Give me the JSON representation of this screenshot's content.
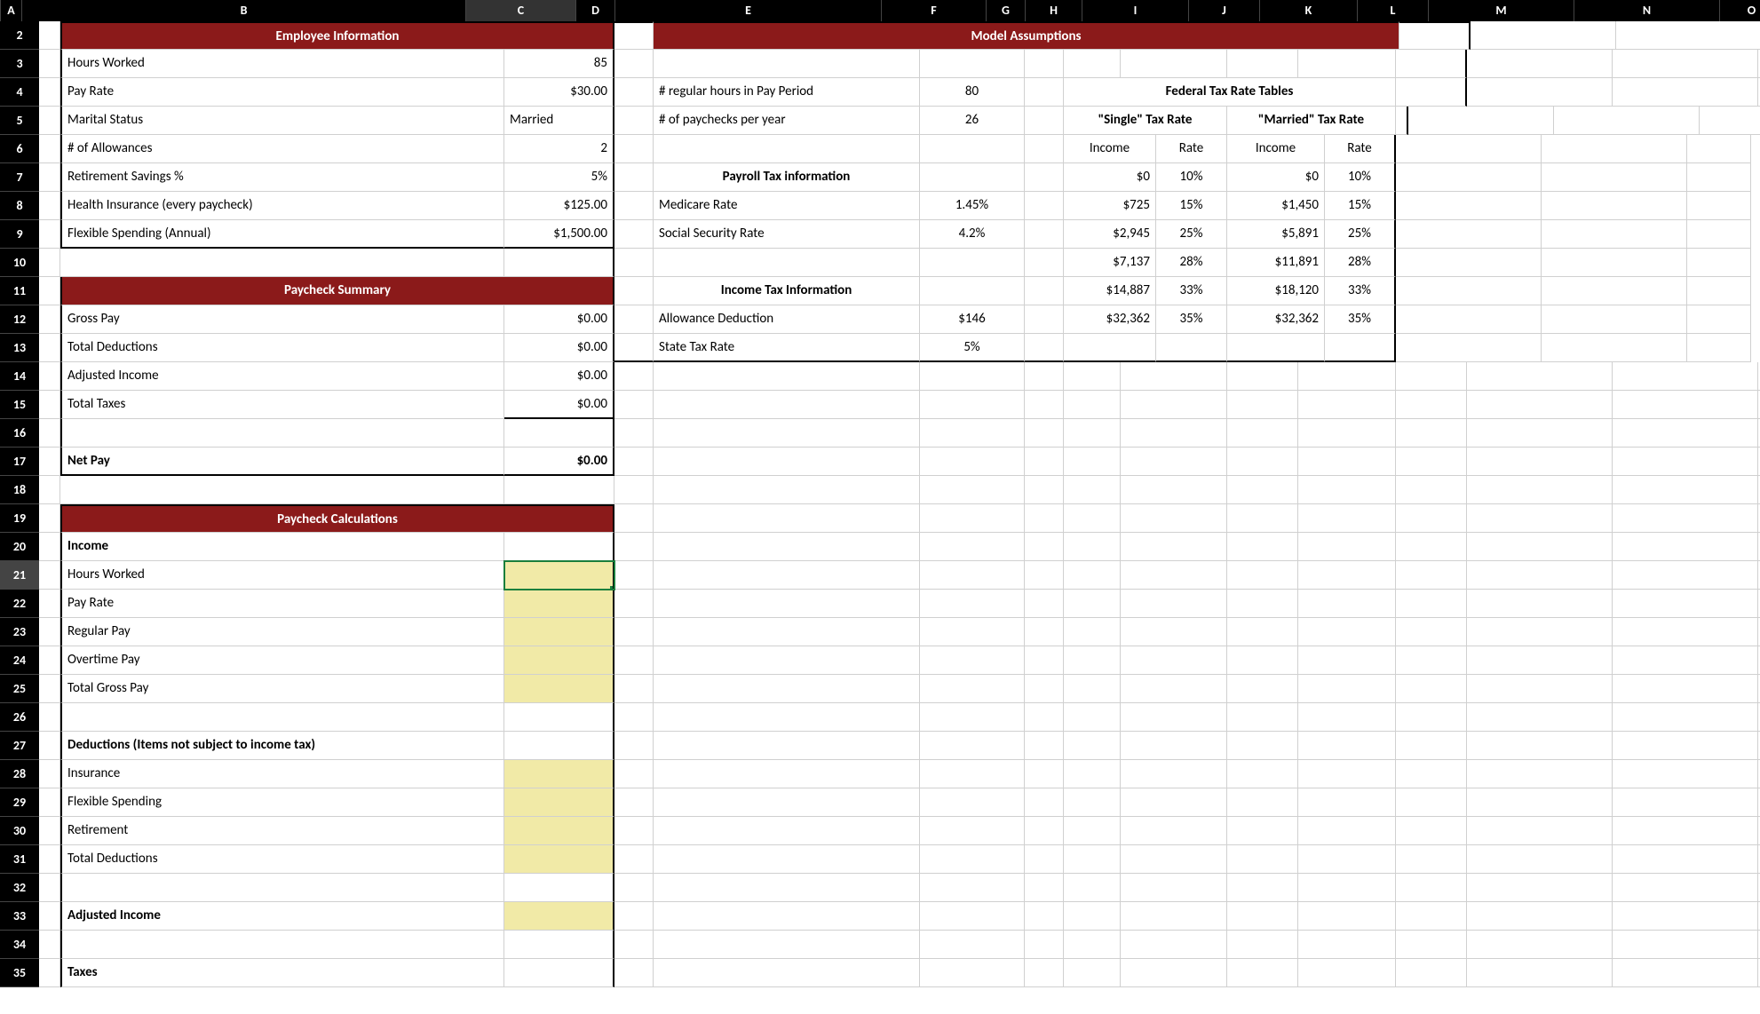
{
  "columns": [
    "A",
    "B",
    "C",
    "D",
    "E",
    "F",
    "G",
    "H",
    "I",
    "J",
    "K",
    "L",
    "M",
    "N",
    "O"
  ],
  "rowStart": 2,
  "rowEnd": 35,
  "selectedRow": 21,
  "selectedCol": "C",
  "headers": {
    "empInfo": "Employee Information",
    "modelAssump": "Model Assumptions",
    "paySummary": "Paycheck Summary",
    "payCalc": "Paycheck Calculations",
    "payrollTax": "Payroll Tax information",
    "incomeTax": "Income Tax Information",
    "fedTaxTables": "Federal Tax Rate Tables",
    "singleRate": "\"Single\" Tax Rate",
    "marriedRate": "\"Married\" Tax Rate",
    "income": "Income",
    "rate": "Rate"
  },
  "empInfo": {
    "hoursWorked": {
      "label": "Hours Worked",
      "value": "85"
    },
    "payRate": {
      "label": "Pay Rate",
      "value": "$30.00"
    },
    "marital": {
      "label": "Marital Status",
      "value": "Married"
    },
    "allowances": {
      "label": "# of Allowances",
      "value": "2"
    },
    "retirement": {
      "label": "Retirement Savings %",
      "value": "5%"
    },
    "health": {
      "label": "Health Insurance (every paycheck)",
      "value": "$125.00"
    },
    "flex": {
      "label": "Flexible Spending (Annual)",
      "value": "$1,500.00"
    }
  },
  "paySummary": {
    "gross": {
      "label": "Gross Pay",
      "value": "$0.00"
    },
    "deduct": {
      "label": "Total Deductions",
      "value": "$0.00"
    },
    "adj": {
      "label": "Adjusted Income",
      "value": "$0.00"
    },
    "tax": {
      "label": "Total Taxes",
      "value": "$0.00"
    },
    "net": {
      "label": "Net Pay",
      "value": "$0.00"
    }
  },
  "payCalc": {
    "incomeHeader": "Income",
    "hoursWorked": "Hours Worked",
    "payRate": "Pay Rate",
    "regularPay": "Regular Pay",
    "overtimePay": "Overtime Pay",
    "totalGross": "Total Gross Pay",
    "deductHeader": "Deductions (Items not subject to income tax)",
    "insurance": "Insurance",
    "flex": "Flexible Spending",
    "retirement": "Retirement",
    "totalDeduct": "Total Deductions",
    "adjIncome": "Adjusted Income",
    "taxes": "Taxes"
  },
  "assump": {
    "regHours": {
      "label": "# regular hours in Pay Period",
      "value": "80"
    },
    "paychecks": {
      "label": "# of paychecks per year",
      "value": "26"
    },
    "medicare": {
      "label": "Medicare Rate",
      "value": "1.45%"
    },
    "ss": {
      "label": "Social Security Rate",
      "value": "4.2%"
    },
    "allowDeduct": {
      "label": "Allowance Deduction",
      "value": "$146"
    },
    "stateTax": {
      "label": "State Tax Rate",
      "value": "5%"
    }
  },
  "singleTable": [
    {
      "income": "$0",
      "rate": "10%"
    },
    {
      "income": "$725",
      "rate": "15%"
    },
    {
      "income": "$2,945",
      "rate": "25%"
    },
    {
      "income": "$7,137",
      "rate": "28%"
    },
    {
      "income": "$14,887",
      "rate": "33%"
    },
    {
      "income": "$32,362",
      "rate": "35%"
    }
  ],
  "marriedTable": [
    {
      "income": "$0",
      "rate": "10%"
    },
    {
      "income": "$1,450",
      "rate": "15%"
    },
    {
      "income": "$5,891",
      "rate": "25%"
    },
    {
      "income": "$11,891",
      "rate": "28%"
    },
    {
      "income": "$18,120",
      "rate": "33%"
    },
    {
      "income": "$32,362",
      "rate": "35%"
    }
  ]
}
